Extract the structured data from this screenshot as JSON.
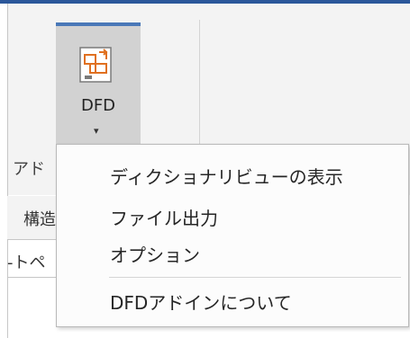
{
  "ribbon": {
    "group_label": "アド",
    "left_row1_label": "構造",
    "left_row2_label": "-トペ",
    "dfd_button": {
      "label": "DFD",
      "icon": "dfd-icon",
      "arrow": "▾"
    }
  },
  "menu": {
    "items": [
      {
        "label": "ディクショナリビューの表示"
      },
      {
        "label": "ファイル出力"
      },
      {
        "label": "オプション"
      },
      {
        "label": "DFDアドインについて"
      }
    ]
  },
  "colors": {
    "accent": "#4a78b8",
    "title_bar": "#2b579a",
    "icon_orange": "#e07020",
    "icon_gray": "#7a7a7a"
  }
}
